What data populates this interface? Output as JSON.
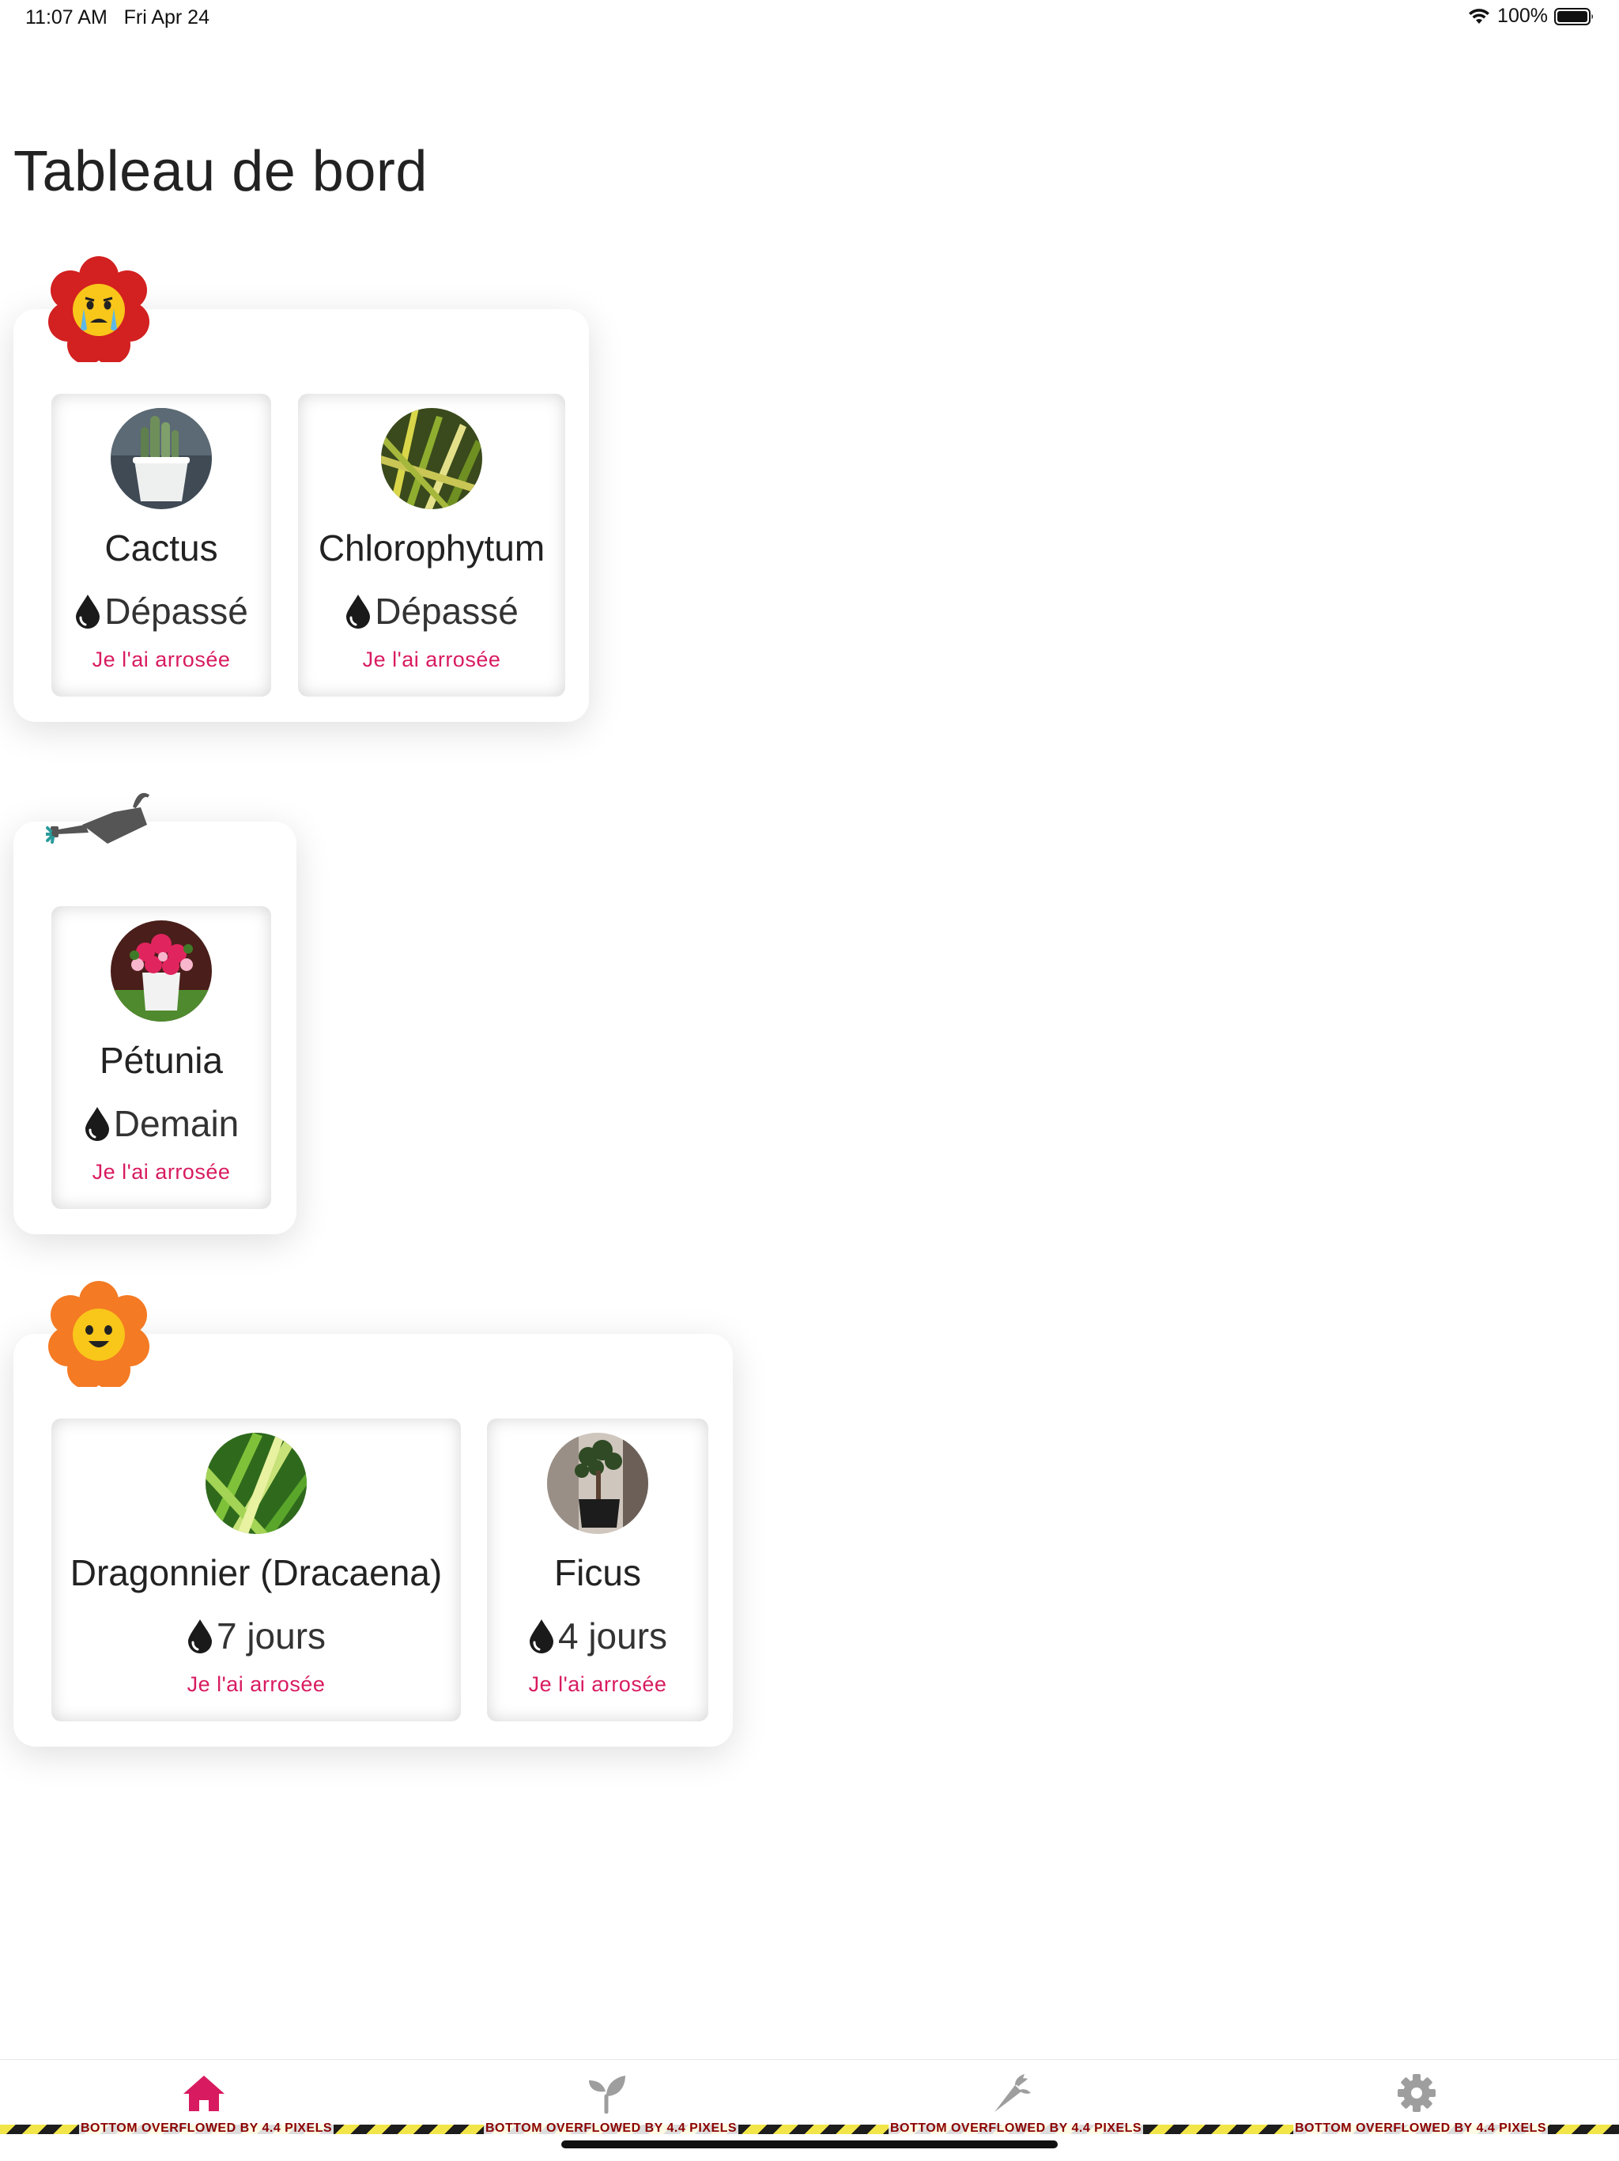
{
  "status_bar": {
    "time_date": "11:07 AM   Fri Apr 24",
    "battery_percent": "100%"
  },
  "header": {
    "title": "Tableau de bord"
  },
  "groups": [
    {
      "icon": "crying-flower-icon",
      "plants": [
        {
          "name": "Cactus",
          "due": "Dépassé",
          "action": "Je l'ai arrosée",
          "photo": "cactus-photo"
        },
        {
          "name": "Chlorophytum",
          "due": "Dépassé",
          "action": "Je l'ai arrosée",
          "photo": "chlorophytum-photo"
        }
      ]
    },
    {
      "icon": "watering-can-icon",
      "plants": [
        {
          "name": "Pétunia",
          "due": "Demain",
          "action": "Je l'ai arrosée",
          "photo": "petunia-photo"
        }
      ]
    },
    {
      "icon": "happy-flower-icon",
      "plants": [
        {
          "name": "Dragonnier (Dracaena)",
          "due": "7 jours",
          "action": "Je l'ai arrosée",
          "photo": "dracaena-photo"
        },
        {
          "name": "Ficus",
          "due": "4 jours",
          "action": "Je l'ai arrosée",
          "photo": "ficus-photo"
        }
      ]
    }
  ],
  "bottom_nav": {
    "items": [
      {
        "icon": "home-icon",
        "active": true
      },
      {
        "icon": "sprout-icon",
        "active": false
      },
      {
        "icon": "carrot-icon",
        "active": false
      },
      {
        "icon": "gear-icon",
        "active": false
      }
    ],
    "overflow_warning": "BOTTOM OVERFLOWED BY 4.4 PIXELS"
  },
  "colors": {
    "accent": "#d81b60",
    "inactive_icon": "#9e9e9e",
    "title": "#222222",
    "card_shadow": "rgba(0,0,0,0.13)"
  }
}
